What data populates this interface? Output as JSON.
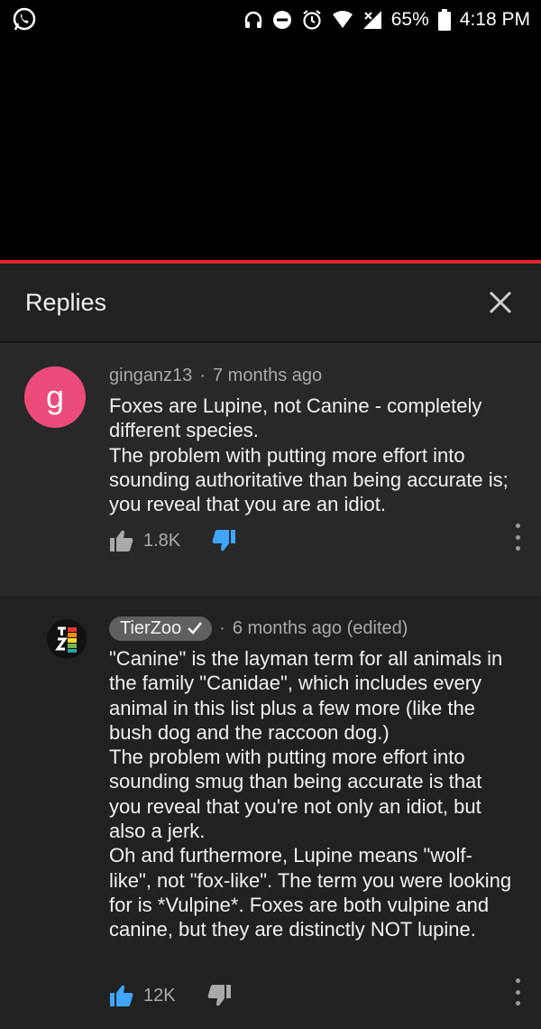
{
  "status_bar": {
    "battery": "65%",
    "time": "4:18 PM",
    "left_icon": "whatsapp-icon",
    "right_icons": [
      "headphones-icon",
      "do-not-disturb-icon",
      "alarm-icon",
      "wifi-icon",
      "signal-icon",
      "battery-icon"
    ]
  },
  "video": {
    "progress_color": "#e0242b"
  },
  "panel": {
    "title": "Replies",
    "close_icon": "close-icon"
  },
  "comments": [
    {
      "avatar_letter": "g",
      "avatar_color": "#ec4c7b",
      "author": "ginganz13",
      "time": "7 months ago",
      "text": "Foxes are Lupine, not Canine - completely different species.\nThe problem with putting more effort into sounding authoritative than being accurate is; you reveal that you are an idiot.",
      "likes": "1.8K",
      "dislike_active": true
    },
    {
      "author": "TierZoo",
      "verified": true,
      "time": "6 months ago (edited)",
      "text": "\"Canine\" is the layman term for all animals in the family \"Canidae\", which includes every animal in this list plus a few more (like the bush dog and the raccoon dog.)\nThe problem with putting more effort into sounding smug than being accurate is that you reveal that you're not only an idiot, but also a jerk.\nOh and furthermore, Lupine means \"wolf-like\", not \"fox-like\". The term you were looking for is *Vulpine*. Foxes are both vulpine and canine, but they are distinctly NOT lupine.",
      "likes": "12K",
      "like_active": true
    }
  ],
  "colors": {
    "accent_blue": "#3ea6ff",
    "panel_bg": "#212121"
  }
}
